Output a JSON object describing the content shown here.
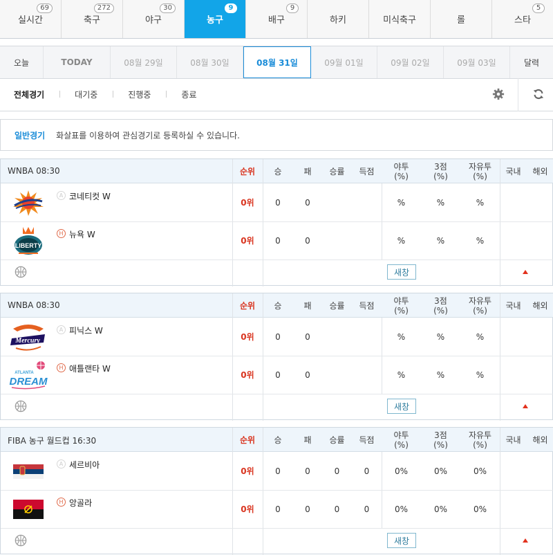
{
  "sports": [
    {
      "label": "실시간",
      "count": "69"
    },
    {
      "label": "축구",
      "count": "272"
    },
    {
      "label": "야구",
      "count": "30"
    },
    {
      "label": "농구",
      "count": "9"
    },
    {
      "label": "배구",
      "count": "9"
    },
    {
      "label": "하키",
      "count": ""
    },
    {
      "label": "미식축구",
      "count": ""
    },
    {
      "label": "롤",
      "count": ""
    },
    {
      "label": "스타",
      "count": "5"
    }
  ],
  "dates": [
    "오늘",
    "TODAY",
    "08월 29일",
    "08월 30일",
    "08월 31일",
    "09월 01일",
    "09월 02일",
    "09월 03일",
    "달력"
  ],
  "filters": [
    "전체경기",
    "대기중",
    "진행중",
    "종료"
  ],
  "notice": {
    "tag": "일반경기",
    "message": "화살표를 이용하여 관심경기로 등록하실 수 있습니다."
  },
  "columns": {
    "rank": "순위",
    "win": "승",
    "loss": "패",
    "pct": "승률",
    "score": "득점",
    "fg1": "야투",
    "fg2": "(%)",
    "tp1": "3점",
    "tp2": "(%)",
    "ft1": "자유투",
    "ft2": "(%)",
    "domestic": "국내",
    "overseas": "해외"
  },
  "new_window_label": "새창",
  "location_marks": {
    "away": "A",
    "home": "H"
  },
  "games": [
    {
      "title": "WNBA   08:30",
      "teams": [
        {
          "name": "코네티컷 W",
          "logo": "sun-logo",
          "rank": "0위",
          "win": "0",
          "loss": "0",
          "pct": "",
          "score": "",
          "fg": "%",
          "tp": "%",
          "ft": "%"
        },
        {
          "name": "뉴욕 W",
          "logo": "liberty-logo",
          "rank": "0위",
          "win": "0",
          "loss": "0",
          "pct": "",
          "score": "",
          "fg": "%",
          "tp": "%",
          "ft": "%"
        }
      ]
    },
    {
      "title": "WNBA   08:30",
      "teams": [
        {
          "name": "피닉스 W",
          "logo": "mercury-logo",
          "rank": "0위",
          "win": "0",
          "loss": "0",
          "pct": "",
          "score": "",
          "fg": "%",
          "tp": "%",
          "ft": "%"
        },
        {
          "name": "애틀랜타 W",
          "logo": "dream-logo",
          "rank": "0위",
          "win": "0",
          "loss": "0",
          "pct": "",
          "score": "",
          "fg": "%",
          "tp": "%",
          "ft": "%"
        }
      ]
    },
    {
      "title": "FIBA 농구 월드컵   16:30",
      "teams": [
        {
          "name": "세르비아",
          "logo": "serbia-flag",
          "rank": "0위",
          "win": "0",
          "loss": "0",
          "pct": "0",
          "score": "0",
          "fg": "0%",
          "tp": "0%",
          "ft": "0%"
        },
        {
          "name": "앙골라",
          "logo": "angola-flag",
          "rank": "0위",
          "win": "0",
          "loss": "0",
          "pct": "0",
          "score": "0",
          "fg": "0%",
          "tp": "0%",
          "ft": "0%"
        }
      ]
    }
  ],
  "colors": {
    "accent": "#12a5e8",
    "active_date": "#1a8cd8",
    "rank_red": "#d9341f",
    "header_bg": "#eef5fb"
  }
}
